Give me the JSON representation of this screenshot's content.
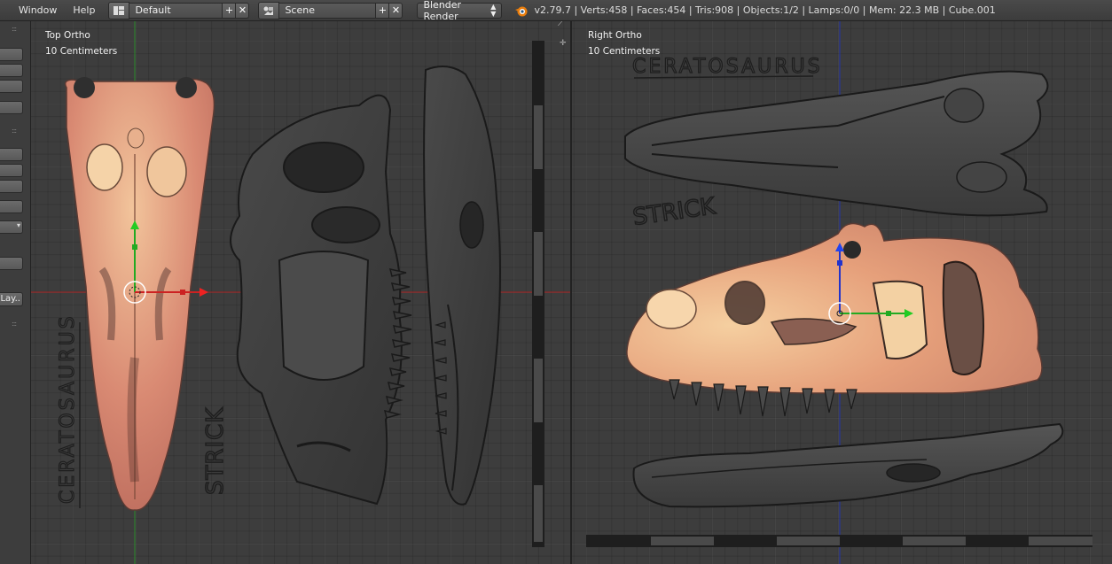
{
  "header": {
    "menus": [
      "Window",
      "Help"
    ],
    "screen_layout": "Default",
    "scene": "Scene",
    "render_engine": "Blender Render",
    "stats": "v2.79.7 | Verts:458 | Faces:454 | Tris:908 | Objects:1/2 | Lamps:0/0 | Mem: 22.3 MB | Cube.001"
  },
  "toolshelf": {
    "layer_button": "Lay.."
  },
  "left_view": {
    "view_name": "Top Ortho",
    "scale": "10 Centimeters",
    "sketch_title": "CERATOSAURUS",
    "sketch_author": "STRICK"
  },
  "right_view": {
    "view_name": "Right Ortho",
    "scale": "10 Centimeters",
    "sketch_title": "CERATOSAURUS",
    "sketch_author": "STRICK"
  },
  "colors": {
    "x_axis": "#cc2222",
    "y_axis": "#22aa22",
    "z_axis": "#2233cc",
    "mesh": "#e8a07a"
  },
  "icons": [
    "screen-layout-icon",
    "scene-icon",
    "add-icon",
    "close-icon",
    "blender-logo-icon",
    "dropdown-arrows-icon",
    "area-split-icon"
  ]
}
